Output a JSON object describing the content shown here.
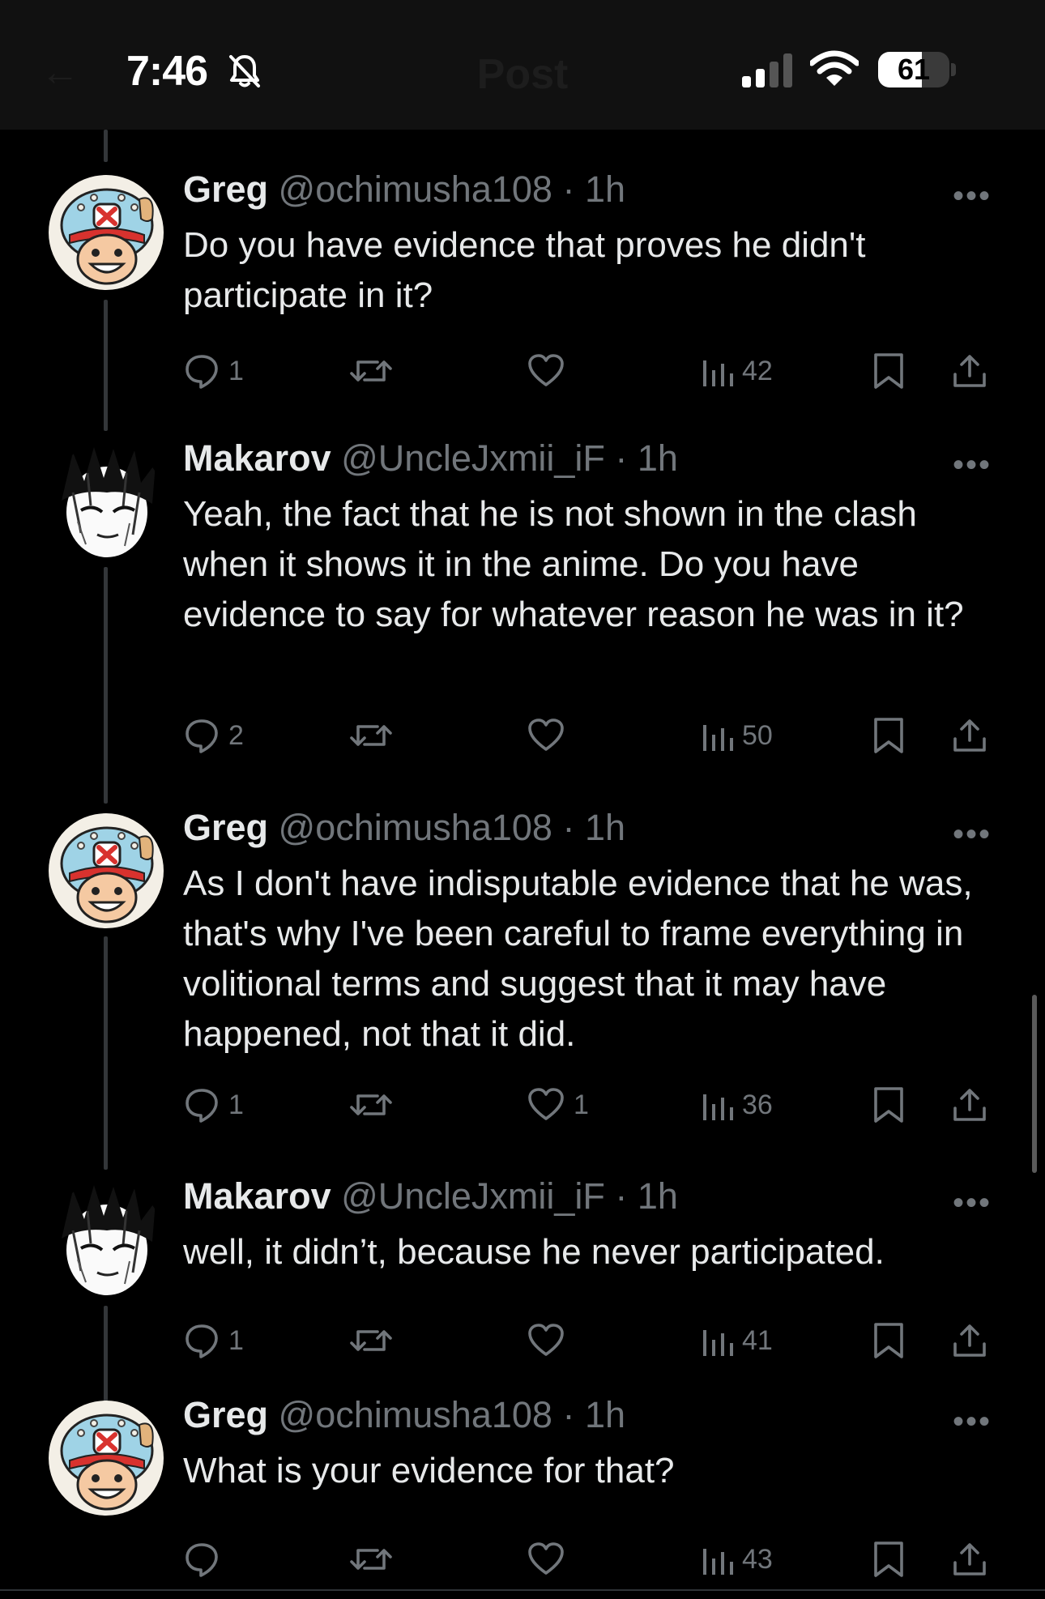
{
  "status_bar": {
    "time": "7:46",
    "battery": "61",
    "battery_level": 0.61,
    "background_title": "Post"
  },
  "replies": [
    {
      "name": "Greg",
      "handle": "@ochimusha108",
      "time": "· 1h",
      "text": "Do you have evidence that proves he didn't participate in it?",
      "replies": "1",
      "reposts": "",
      "likes": "",
      "views": "42",
      "avatar": "chopper"
    },
    {
      "name": "Makarov",
      "handle": "@UncleJxmii_iF",
      "time": "· 1h",
      "text": "Yeah, the fact that he is not shown in the clash when it shows it in the anime. Do you have evidence to say for whatever reason he was in it?",
      "replies": "2",
      "reposts": "",
      "likes": "",
      "views": "50",
      "avatar": "manga"
    },
    {
      "name": "Greg",
      "handle": "@ochimusha108",
      "time": "· 1h",
      "text": "As I don't have indisputable evidence that he was, that's why I've been careful to frame everything in volitional terms and suggest that it may have happened, not that it did.",
      "replies": "1",
      "reposts": "",
      "likes": "1",
      "views": "36",
      "avatar": "chopper"
    },
    {
      "name": "Makarov",
      "handle": "@UncleJxmii_iF",
      "time": "· 1h",
      "text": "well, it didn’t, because he never participated.",
      "replies": "1",
      "reposts": "",
      "likes": "",
      "views": "41",
      "avatar": "manga"
    },
    {
      "name": "Greg",
      "handle": "@ochimusha108",
      "time": "· 1h",
      "text": "What is your evidence for that?",
      "replies": "",
      "reposts": "",
      "likes": "",
      "views": "43",
      "avatar": "chopper"
    }
  ],
  "colors": {
    "background": "#000000",
    "text": "#e7e9ea",
    "secondary": "#71767b",
    "thread_line": "#333639"
  }
}
